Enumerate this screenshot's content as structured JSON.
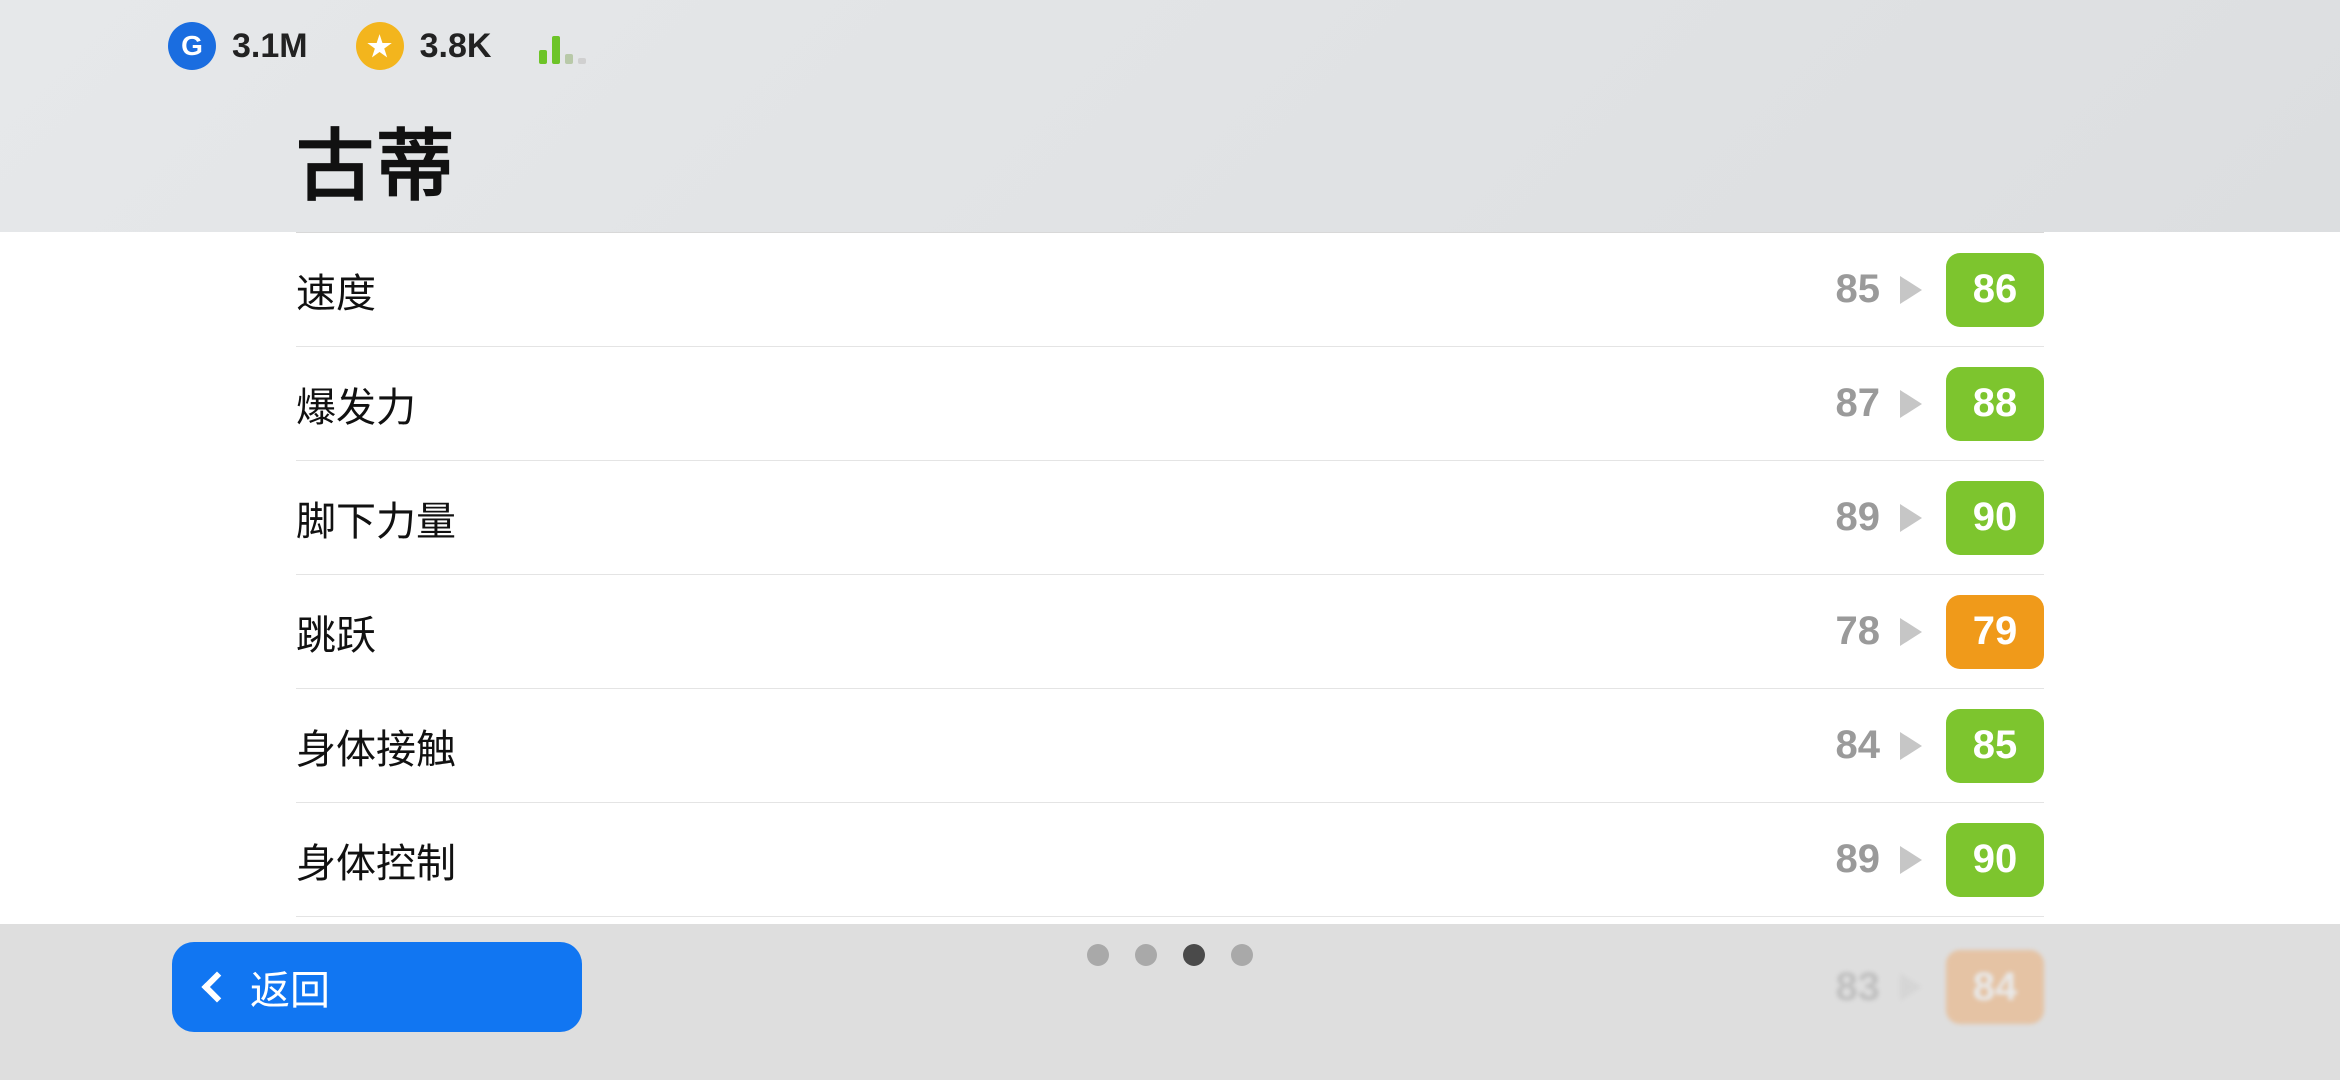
{
  "currency": {
    "g_icon": "G",
    "g_value": "3.1M",
    "star_icon": "★",
    "star_value": "3.8K"
  },
  "player": {
    "name": "古蒂"
  },
  "stats": [
    {
      "label": "速度",
      "base": "85",
      "next": "86",
      "color": "#7dc52e"
    },
    {
      "label": "爆发力",
      "base": "87",
      "next": "88",
      "color": "#7dc52e"
    },
    {
      "label": "脚下力量",
      "base": "89",
      "next": "90",
      "color": "#7dc52e"
    },
    {
      "label": "跳跃",
      "base": "78",
      "next": "79",
      "color": "#f09a1a"
    },
    {
      "label": "身体接触",
      "base": "84",
      "next": "85",
      "color": "#7dc52e"
    },
    {
      "label": "身体控制",
      "base": "89",
      "next": "90",
      "color": "#7dc52e"
    }
  ],
  "footer": {
    "back_label": "返回",
    "blurred_base": "83",
    "blurred_next": "84"
  },
  "pager": {
    "count": 4,
    "active": 2
  }
}
